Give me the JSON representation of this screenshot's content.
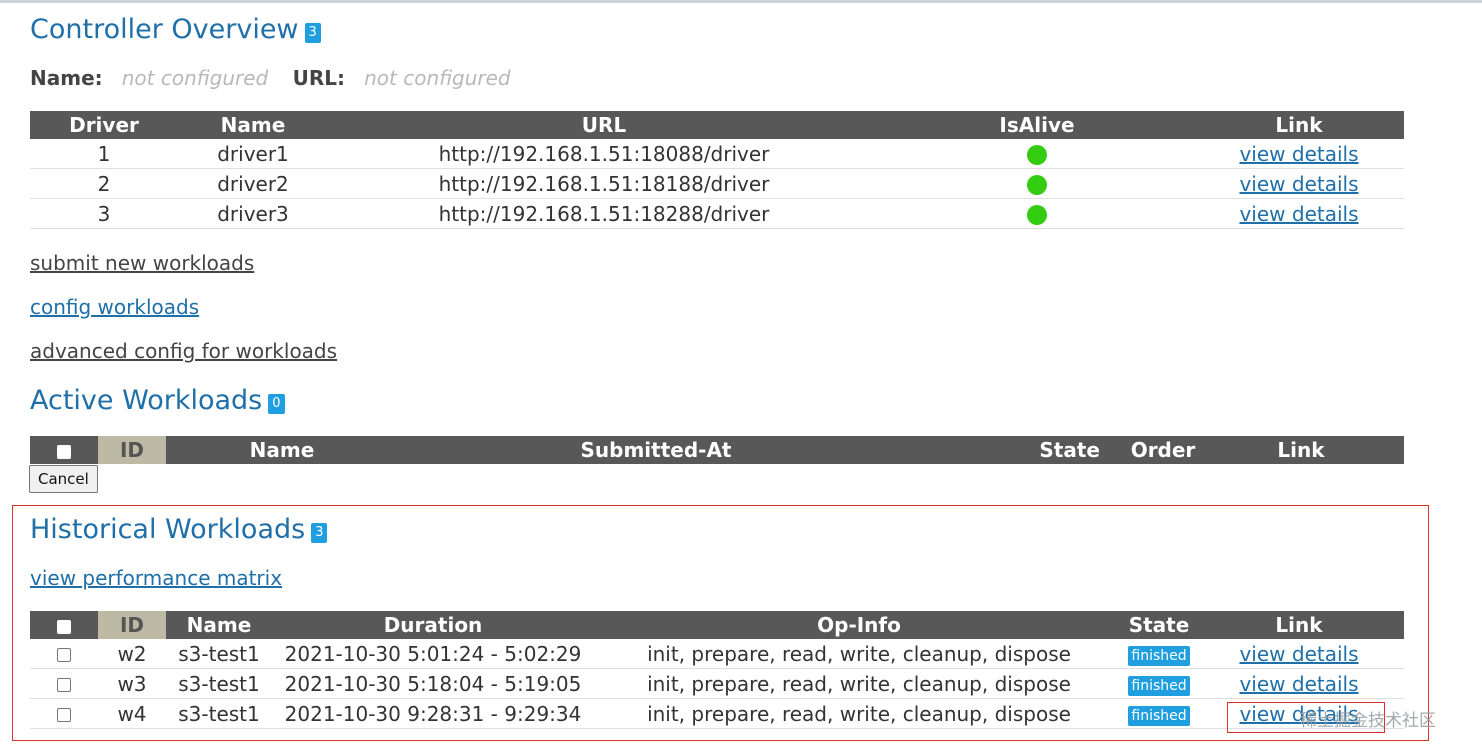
{
  "controller": {
    "title": "Controller Overview",
    "count": "3",
    "name_label": "Name",
    "name_value": "not configured",
    "url_label": "URL",
    "url_value": "not configured",
    "columns": [
      "Driver",
      "Name",
      "URL",
      "IsAlive",
      "Link"
    ],
    "drivers": [
      {
        "id": "1",
        "name": "driver1",
        "url": "http://192.168.1.51:18088/driver",
        "alive": true,
        "link": "view details"
      },
      {
        "id": "2",
        "name": "driver2",
        "url": "http://192.168.1.51:18188/driver",
        "alive": true,
        "link": "view details"
      },
      {
        "id": "3",
        "name": "driver3",
        "url": "http://192.168.1.51:18288/driver",
        "alive": true,
        "link": "view details"
      }
    ]
  },
  "links": {
    "submit": "submit new workloads",
    "config": "config workloads",
    "advanced": "advanced config for workloads"
  },
  "active": {
    "title": "Active Workloads",
    "count": "0",
    "columns": [
      "ID",
      "Name",
      "Submitted-At",
      "State",
      "Order",
      "Link"
    ],
    "cancel_label": "Cancel"
  },
  "historical": {
    "title": "Historical Workloads",
    "count": "3",
    "matrix_link": "view performance matrix",
    "columns": [
      "ID",
      "Name",
      "Duration",
      "Op-Info",
      "State",
      "Link"
    ],
    "rows": [
      {
        "id": "w2",
        "name": "s3-test1",
        "duration": "2021-10-30 5:01:24 - 5:02:29",
        "opinfo": "init, prepare, read, write, cleanup, dispose",
        "state": "finished",
        "link": "view details"
      },
      {
        "id": "w3",
        "name": "s3-test1",
        "duration": "2021-10-30 5:18:04 - 5:19:05",
        "opinfo": "init, prepare, read, write, cleanup, dispose",
        "state": "finished",
        "link": "view details"
      },
      {
        "id": "w4",
        "name": "s3-test1",
        "duration": "2021-10-30 9:28:31 - 9:29:34",
        "opinfo": "init, prepare, read, write, cleanup, dispose",
        "state": "finished",
        "link": "view details"
      }
    ]
  },
  "watermark": "稀土掘金技术社区",
  "colors": {
    "accent": "#1f6fa8",
    "badge": "#1f9ee0",
    "alive": "#33cc11",
    "header": "#585858",
    "highlight": "#d9342b"
  }
}
